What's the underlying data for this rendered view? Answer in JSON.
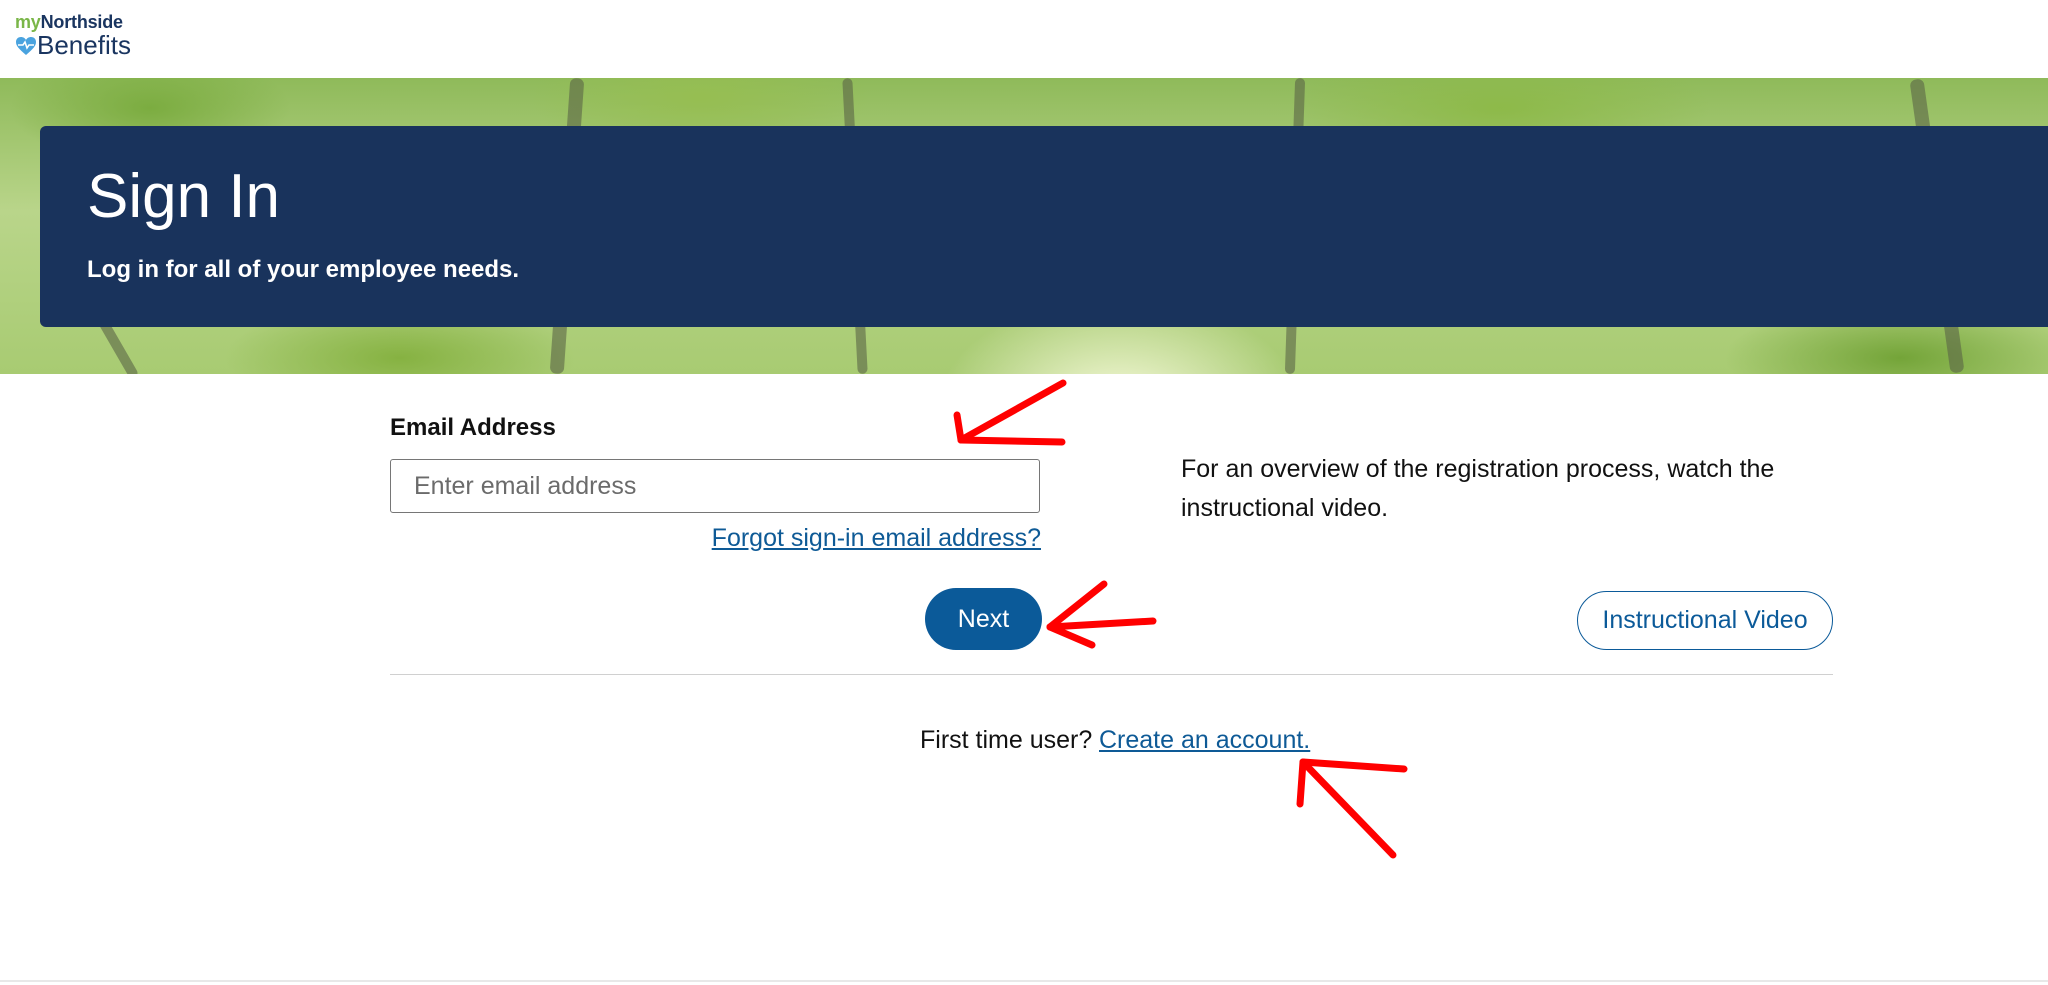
{
  "logo": {
    "prefix": "my",
    "brand": "Northside",
    "product": "Benefits"
  },
  "banner": {
    "title": "Sign In",
    "subtitle": "Log in for all of your employee needs."
  },
  "form": {
    "email_label": "Email Address",
    "email_placeholder": "Enter email address",
    "email_value": "",
    "forgot_link": "Forgot sign-in email address?",
    "next_button": "Next"
  },
  "overview": {
    "text": "For an overview of the registration process, watch the instructional video.",
    "video_button": "Instructional Video"
  },
  "footer_prompt": {
    "text": "First time user?",
    "link": "Create an account."
  },
  "colors": {
    "banner_bg": "#19335c",
    "primary_button": "#0b5a99",
    "link": "#0e5a96",
    "annotation_arrow": "#ff0000"
  }
}
